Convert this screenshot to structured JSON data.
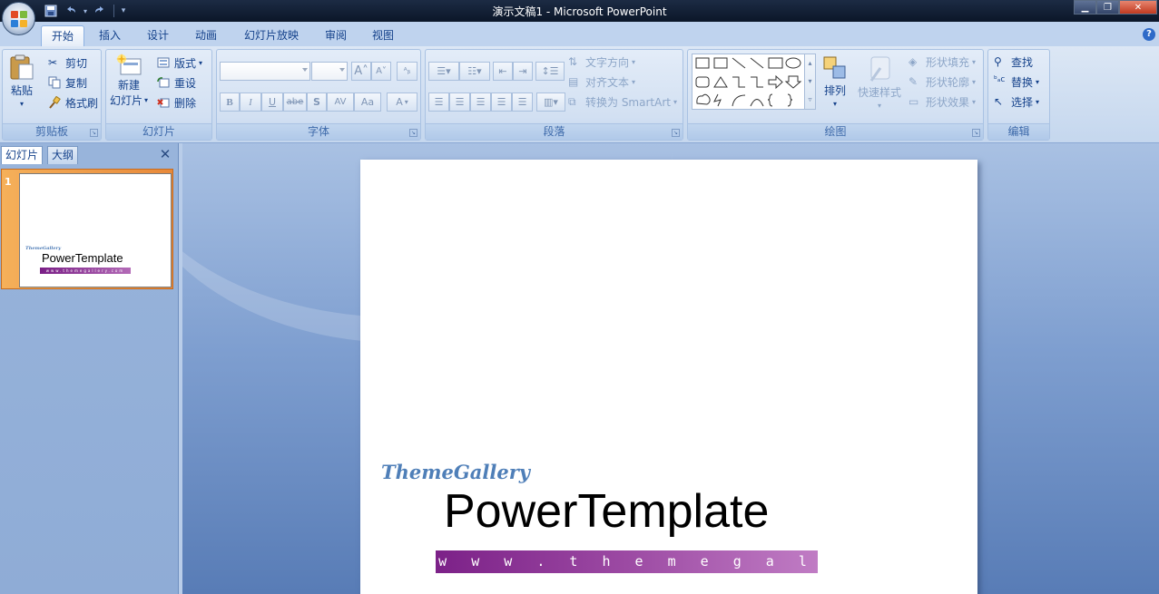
{
  "window": {
    "title": "演示文稿1 - Microsoft PowerPoint"
  },
  "tabs": [
    "开始",
    "插入",
    "设计",
    "动画",
    "幻灯片放映",
    "审阅",
    "视图"
  ],
  "ribbon": {
    "clipboard": {
      "label": "剪贴板",
      "paste": "粘贴",
      "cut": "剪切",
      "copy": "复制",
      "format_painter": "格式刷"
    },
    "slides": {
      "label": "幻灯片",
      "new_slide_line1": "新建",
      "new_slide_line2": "幻灯片",
      "layout": "版式",
      "reset": "重设",
      "delete": "删除"
    },
    "font": {
      "label": "字体",
      "bold": "B",
      "italic": "I",
      "underline": "U",
      "strike": "abe",
      "shadow": "S",
      "spacing": "AV",
      "case": "Aa",
      "color": "A",
      "grow": "A",
      "shrink": "A"
    },
    "paragraph": {
      "label": "段落",
      "text_direction": "文字方向",
      "align_text": "对齐文本",
      "smartart": "转换为 SmartArt"
    },
    "drawing": {
      "label": "绘图",
      "arrange": "排列",
      "quick_styles": "快速样式",
      "shape_fill": "形状填充",
      "shape_outline": "形状轮廓",
      "shape_effects": "形状效果"
    },
    "editing": {
      "label": "编辑",
      "find": "查找",
      "replace": "替换",
      "select": "选择"
    }
  },
  "left_pane": {
    "tabs": [
      "幻灯片",
      "大纲"
    ],
    "close": "✕",
    "slide_number": "1",
    "thumb": {
      "brand": "ThemeGallery",
      "title": "PowerTemplate",
      "url": "www.themegallery.com"
    }
  },
  "slide": {
    "brand": "ThemeGallery",
    "title": "PowerTemplate",
    "url": "w w w . t h e m e g a l l e r y . c o m"
  },
  "colors": {
    "accent_purple": "#7c2188",
    "ribbon_text": "#15428b",
    "selected_thumb": "#f5b05a"
  }
}
